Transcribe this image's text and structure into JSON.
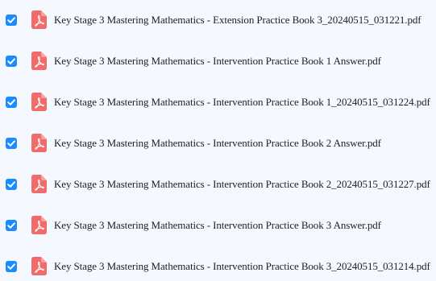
{
  "icons": {
    "checkbox": "checkbox-checked-icon",
    "file": "pdf-file-icon"
  },
  "colors": {
    "background": "#f5f9ff",
    "checkbox": "#1a8cff",
    "pdf_icon": "#f26b6b",
    "text": "#1f1f1f"
  },
  "files": [
    {
      "name": "Key Stage 3 Mastering Mathematics - Extension Practice Book 3_20240515_031221.pdf",
      "checked": true
    },
    {
      "name": "Key Stage 3 Mastering Mathematics - Intervention Practice Book 1 Answer.pdf",
      "checked": true
    },
    {
      "name": "Key Stage 3 Mastering Mathematics - Intervention Practice Book 1_20240515_031224.pdf",
      "checked": true
    },
    {
      "name": "Key Stage 3 Mastering Mathematics - Intervention Practice Book 2 Answer.pdf",
      "checked": true
    },
    {
      "name": "Key Stage 3 Mastering Mathematics - Intervention Practice Book 2_20240515_031227.pdf",
      "checked": true
    },
    {
      "name": "Key Stage 3 Mastering Mathematics - Intervention Practice Book 3 Answer.pdf",
      "checked": true
    },
    {
      "name": "Key Stage 3 Mastering Mathematics - Intervention Practice Book 3_20240515_031214.pdf",
      "checked": true
    }
  ]
}
